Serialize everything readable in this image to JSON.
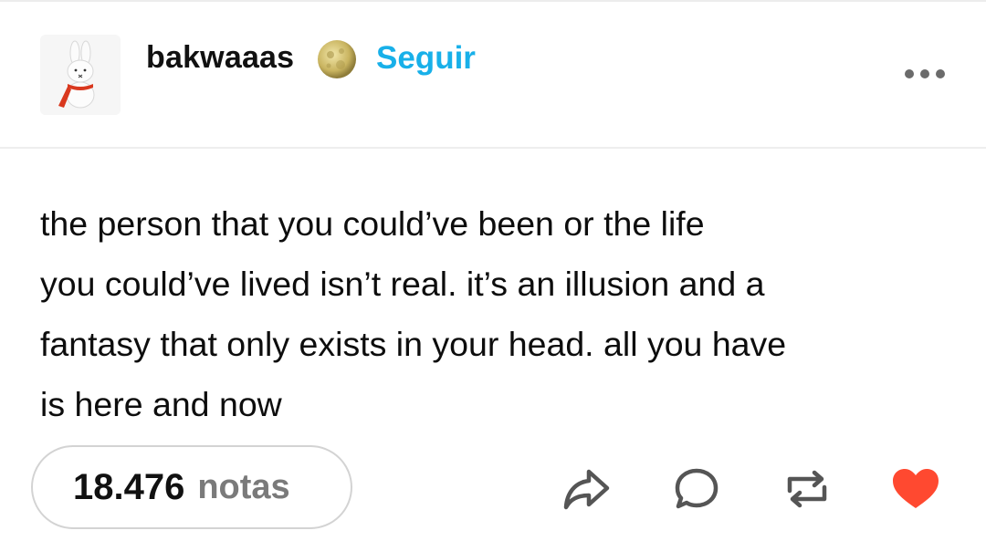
{
  "post": {
    "username": "bakwaaas",
    "follow_label": "Seguir",
    "body": "the person that you could’ve been or the life\nyou could’ve lived isn’t real. it’s an illusion and a\nfantasy that only exists in your head. all you have\nis here and now",
    "notes_count": "18.476",
    "notes_label": "notas"
  },
  "icons": {
    "avatar": "bunny-avatar",
    "badge": "moon-icon",
    "more": "more-options-icon",
    "share": "share-icon",
    "reply": "reply-icon",
    "reblog": "reblog-icon",
    "like": "heart-icon"
  },
  "colors": {
    "accent": "#18b0e9",
    "like": "#ff4930",
    "notes_label": "#7a7a7a"
  }
}
